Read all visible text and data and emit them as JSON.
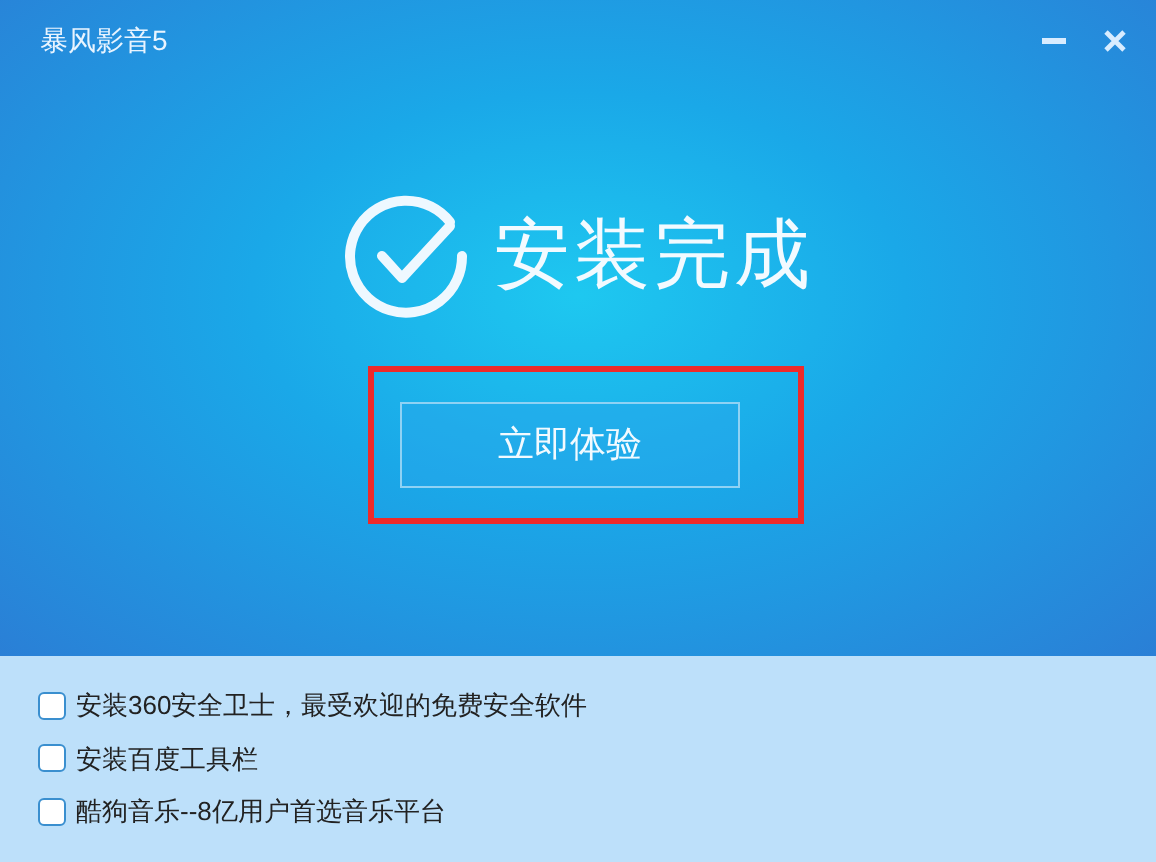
{
  "window": {
    "title": "暴风影音5"
  },
  "heading": "安装完成",
  "button": {
    "label": "立即体验",
    "highlighted": true
  },
  "options": [
    {
      "label": "安装360安全卫士，最受欢迎的免费安全软件",
      "checked": false
    },
    {
      "label": "安装百度工具栏",
      "checked": false
    },
    {
      "label": "酷狗音乐--8亿用户首选音乐平台",
      "checked": false
    }
  ]
}
